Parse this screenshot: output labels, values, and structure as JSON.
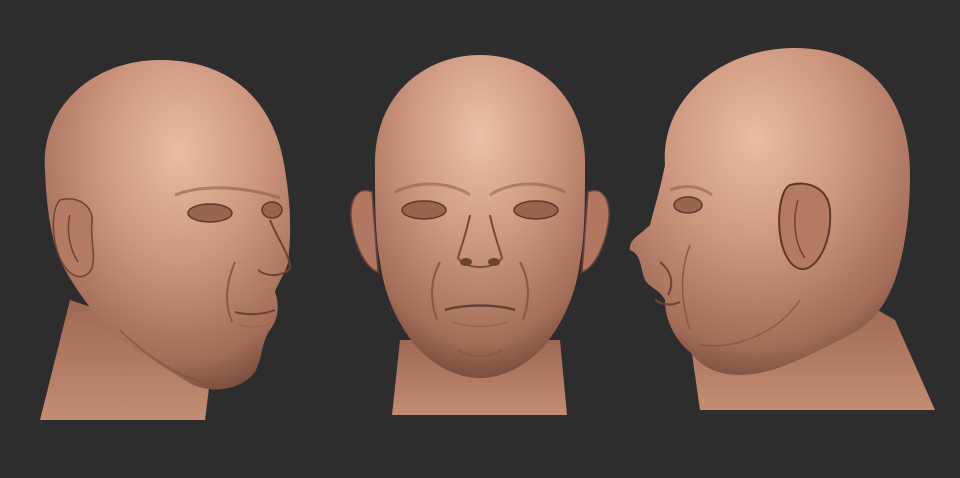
{
  "scene": {
    "description_visible_text": "",
    "background_color": "#2d2d2d",
    "skin_base": "#c88f78",
    "skin_highlight": "#e6b6a0",
    "skin_shadow": "#7a4c3e",
    "views": [
      {
        "name": "three-quarter-right-view"
      },
      {
        "name": "front-view"
      },
      {
        "name": "left-profile-view"
      }
    ]
  }
}
